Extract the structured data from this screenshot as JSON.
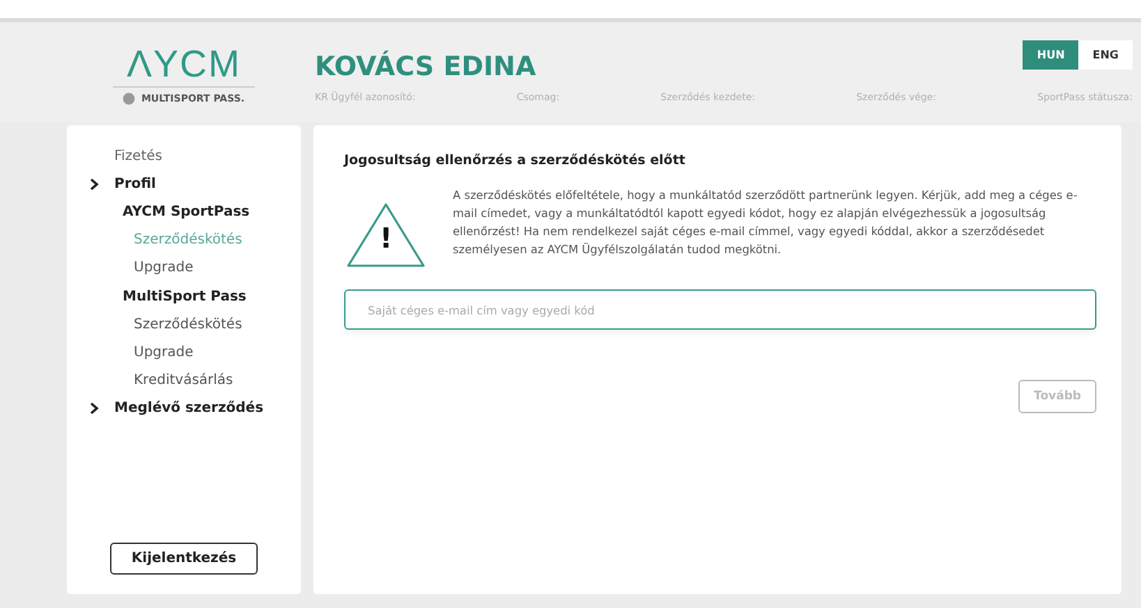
{
  "header": {
    "logo": "ΛYCM",
    "logo_sub": "MULTISPORT PASS.",
    "user_name": "KOVÁCS EDINA",
    "fields": [
      "KR Ügyfél azonosító:",
      "Csomag:",
      "Szerződés kezdete:",
      "Szerződés vége:",
      "SportPass státusza:"
    ],
    "languages": [
      {
        "label": "HUN",
        "selected": true
      },
      {
        "label": "ENG",
        "selected": false
      }
    ]
  },
  "sidebar": {
    "items": [
      {
        "label": "Fizetés",
        "kind": "plain",
        "selected": false
      },
      {
        "label": "Profil",
        "kind": "section",
        "selected": false
      },
      {
        "label": "AYCM SportPass",
        "kind": "heading",
        "selected": false
      },
      {
        "label": "Szerződéskötés",
        "kind": "sub",
        "selected": true
      },
      {
        "label": "Upgrade",
        "kind": "sub",
        "selected": false
      },
      {
        "label": "MultiSport Pass",
        "kind": "heading",
        "selected": false
      },
      {
        "label": "Szerződéskötés",
        "kind": "sub",
        "selected": false
      },
      {
        "label": "Upgrade",
        "kind": "sub",
        "selected": false
      },
      {
        "label": "Kreditvásárlás",
        "kind": "sub",
        "selected": false
      },
      {
        "label": "Meglévő szerződés",
        "kind": "section",
        "selected": false
      }
    ],
    "logout": "Kijelentkezés"
  },
  "main": {
    "title": "Jogosultság ellenőrzés a szerződéskötés előtt",
    "warning_icon": "!",
    "notice": "A szerződéskötés előfeltétele, hogy a munkáltatód szerződött partnerünk legyen. Kérjük, add meg a céges e-mail címedet, vagy a munkáltatódtól kapott egyedi kódot, hogy ez alapján elvégezhessük a jogosultság ellenőrzést! Ha nem rendelkezel saját céges e-mail címmel, vagy egyedi kóddal, akkor a szerződésedet személyesen az AYCM Ügyfélszolgálatán tudod megkötni.",
    "input": {
      "placeholder": "Saját céges e-mail cím vagy egyedi kód"
    },
    "next_button": {
      "label": "Tovább",
      "disabled": true
    }
  }
}
